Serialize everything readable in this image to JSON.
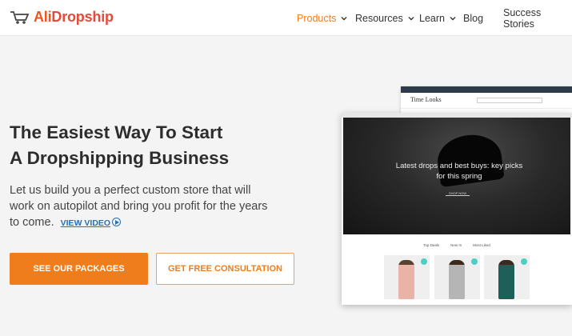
{
  "header": {
    "logo_text_1": "Ali",
    "logo_text_2": "Dropship",
    "nav": [
      {
        "label": "Products",
        "dropdown": true,
        "active": true
      },
      {
        "label": "Resources",
        "dropdown": true
      },
      {
        "label": "Learn",
        "dropdown": true
      },
      {
        "label": "Blog",
        "dropdown": false
      },
      {
        "label": "Success Stories",
        "dropdown": false
      }
    ]
  },
  "hero": {
    "title_line1": "The Easiest Way To Start",
    "title_line2": "A Dropshipping Business",
    "description": "Let us build you a perfect custom store that will work on autopilot and bring you profit for the years to come.",
    "video_link": "VIEW VIDEO",
    "primary_button": "SEE OUR PACKAGES",
    "secondary_button": "GET FREE CONSULTATION"
  },
  "mockup": {
    "back_brand": "Time Looks",
    "hero_caption": "Latest drops and best buys: key picks for this spring",
    "shop_button": "SHOP NOW",
    "tabs": [
      "Top Deals",
      "New In",
      "Most Liked"
    ]
  },
  "colors": {
    "accent": "#f07d1c",
    "link": "#2a6fb0",
    "badge": "#4ecdc4"
  }
}
